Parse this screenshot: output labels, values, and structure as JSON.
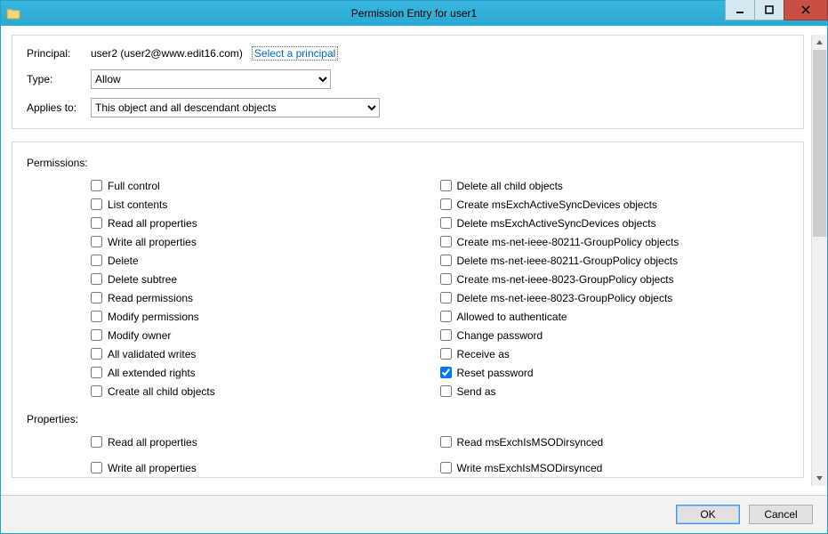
{
  "window": {
    "title": "Permission Entry for user1"
  },
  "header": {
    "principal_label": "Principal:",
    "principal_value": "user2 (user2@www.edit16.com)",
    "select_principal_link": "Select a principal",
    "type_label": "Type:",
    "type_value": "Allow",
    "applies_label": "Applies to:",
    "applies_value": "This object and all descendant objects"
  },
  "sections": {
    "permissions_label": "Permissions:",
    "properties_label": "Properties:"
  },
  "permissions_left": [
    {
      "label": "Full control",
      "checked": false
    },
    {
      "label": "List contents",
      "checked": false
    },
    {
      "label": "Read all properties",
      "checked": false
    },
    {
      "label": "Write all properties",
      "checked": false
    },
    {
      "label": "Delete",
      "checked": false
    },
    {
      "label": "Delete subtree",
      "checked": false
    },
    {
      "label": "Read permissions",
      "checked": false
    },
    {
      "label": "Modify permissions",
      "checked": false
    },
    {
      "label": "Modify owner",
      "checked": false
    },
    {
      "label": "All validated writes",
      "checked": false
    },
    {
      "label": "All extended rights",
      "checked": false
    },
    {
      "label": "Create all child objects",
      "checked": false
    }
  ],
  "permissions_right": [
    {
      "label": "Delete all child objects",
      "checked": false
    },
    {
      "label": "Create msExchActiveSyncDevices objects",
      "checked": false
    },
    {
      "label": "Delete msExchActiveSyncDevices objects",
      "checked": false
    },
    {
      "label": "Create ms-net-ieee-80211-GroupPolicy objects",
      "checked": false
    },
    {
      "label": "Delete ms-net-ieee-80211-GroupPolicy objects",
      "checked": false
    },
    {
      "label": "Create ms-net-ieee-8023-GroupPolicy objects",
      "checked": false
    },
    {
      "label": "Delete ms-net-ieee-8023-GroupPolicy objects",
      "checked": false
    },
    {
      "label": "Allowed to authenticate",
      "checked": false
    },
    {
      "label": "Change password",
      "checked": false
    },
    {
      "label": "Receive as",
      "checked": false
    },
    {
      "label": "Reset password",
      "checked": true
    },
    {
      "label": "Send as",
      "checked": false
    }
  ],
  "properties_left": [
    {
      "label": "Read all properties",
      "checked": false
    },
    {
      "label": "Write all properties",
      "checked": false
    }
  ],
  "properties_right": [
    {
      "label": "Read msExchIsMSODirsynced",
      "checked": false
    },
    {
      "label": "Write msExchIsMSODirsynced",
      "checked": false
    }
  ],
  "footer": {
    "ok": "OK",
    "cancel": "Cancel"
  }
}
